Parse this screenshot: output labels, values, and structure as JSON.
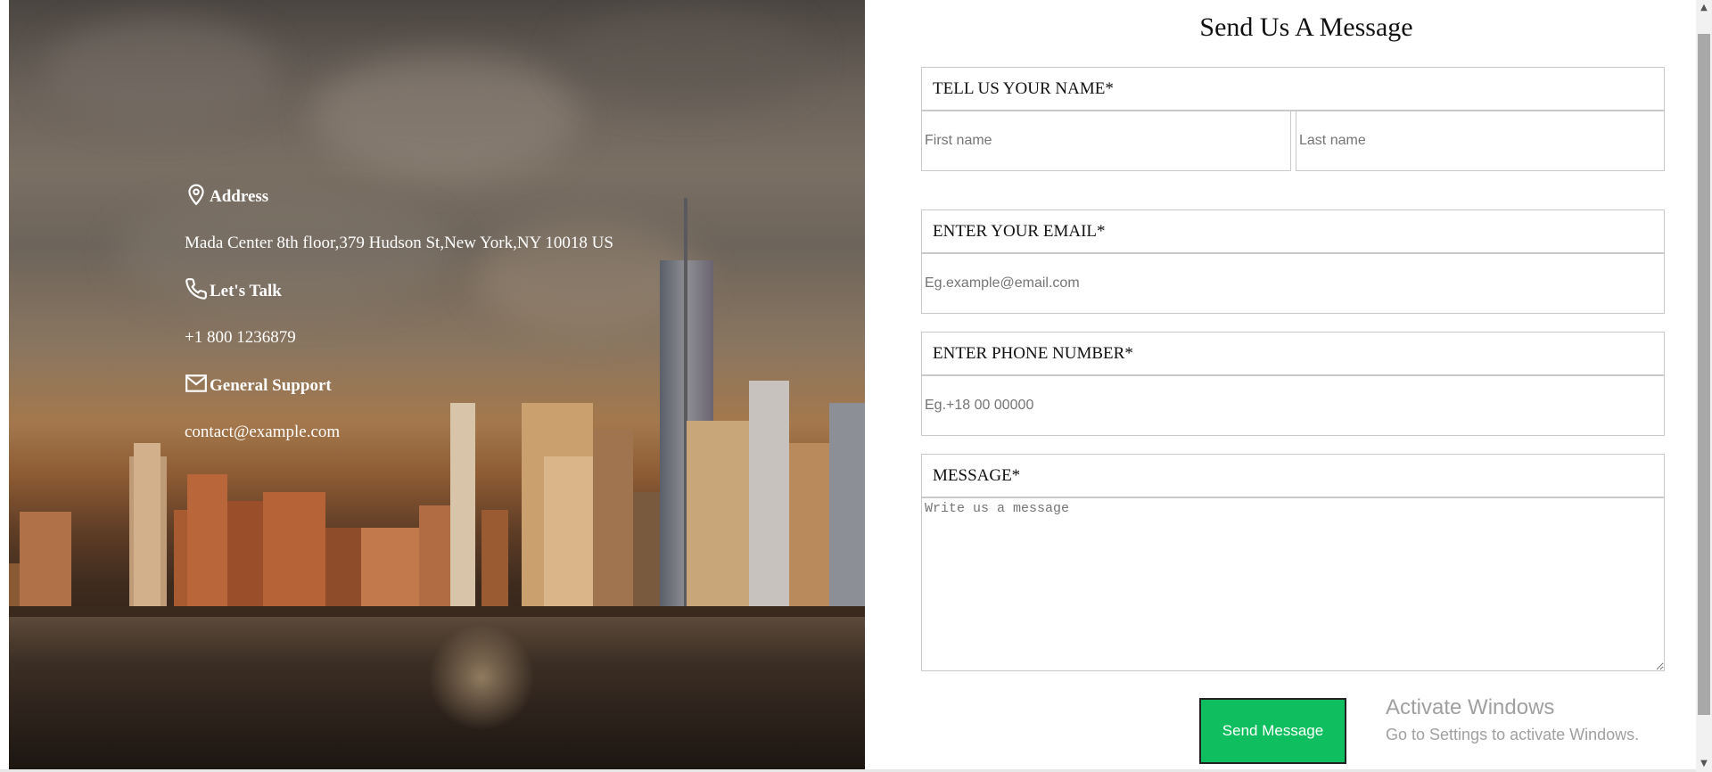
{
  "contact": {
    "address_heading": "Address",
    "address_text": "Mada Center 8th floor,379 Hudson St,New York,NY 10018 US",
    "talk_heading": "Let's Talk",
    "phone_text": "+1 800 1236879",
    "support_heading": "General Support",
    "email_text": "contact@example.com",
    "icons": [
      "location-pin-icon",
      "phone-icon",
      "mail-icon"
    ]
  },
  "form": {
    "title": "Send Us A Message",
    "name_label": "TELL US YOUR NAME*",
    "first_name_placeholder": "First name",
    "last_name_placeholder": "Last name",
    "email_label": "ENTER YOUR EMAIL*",
    "email_placeholder": "Eg.example@email.com",
    "phone_label": "ENTER PHONE NUMBER*",
    "phone_placeholder": "Eg.+18 00 00000",
    "message_label": "MESSAGE*",
    "message_placeholder": "Write us a message",
    "submit_label": "Send Message"
  },
  "watermark": {
    "line1": "Activate Windows",
    "line2": "Go to Settings to activate Windows."
  },
  "colors": {
    "submit_bg": "#0fbf5f",
    "border": "#c9c9c9"
  }
}
